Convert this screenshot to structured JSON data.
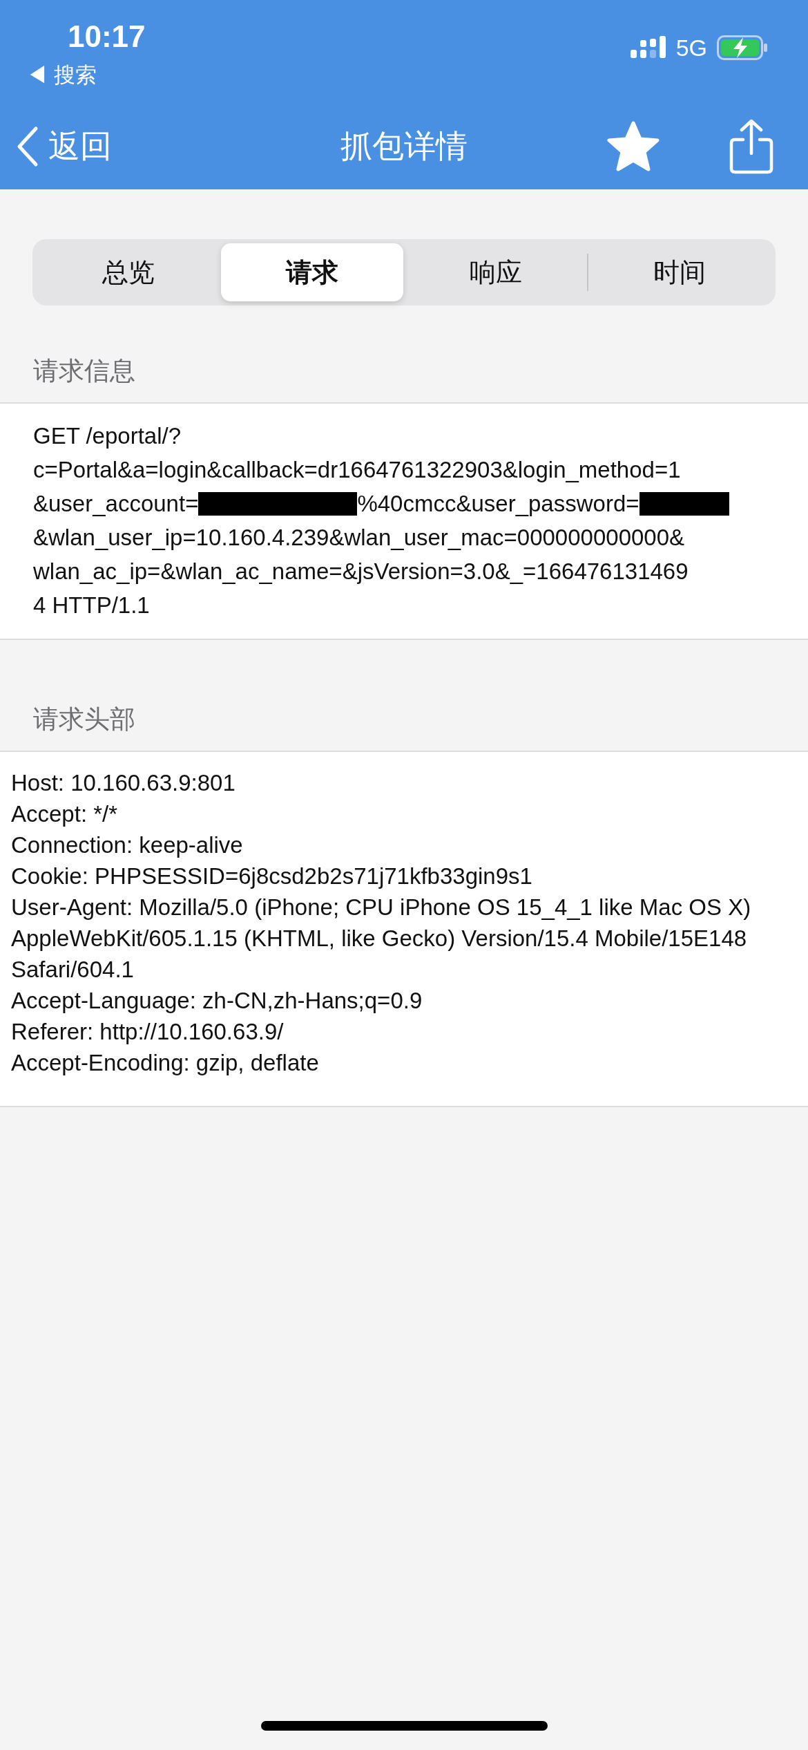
{
  "status_bar": {
    "time": "10:17",
    "back_app": "◀ 搜索",
    "network": "5G"
  },
  "nav_bar": {
    "back": "返回",
    "title": "抓包详情"
  },
  "tabs": [
    {
      "label": "总览",
      "selected": false
    },
    {
      "label": "请求",
      "selected": true
    },
    {
      "label": "响应",
      "selected": false
    },
    {
      "label": "时间",
      "selected": false
    }
  ],
  "request_info": {
    "heading": "请求信息",
    "lines": [
      [
        {
          "kind": "text",
          "text": "GET /eportal/?"
        }
      ],
      [
        {
          "kind": "text",
          "text": "c=Portal&a=login&callback=dr1664761322903&login_method=1"
        }
      ],
      [
        {
          "kind": "text",
          "text": "&user_account="
        },
        {
          "kind": "redacted"
        },
        {
          "kind": "text",
          "text": "%40cmcc&user_password="
        },
        {
          "kind": "redacted"
        }
      ],
      [
        {
          "kind": "text",
          "text": "&wlan_user_ip=10.160.4.239&wlan_user_mac=000000000000&"
        }
      ],
      [
        {
          "kind": "text",
          "text": "wlan_ac_ip=&wlan_ac_name=&jsVersion=3.0&_=166476131469"
        }
      ],
      [
        {
          "kind": "text",
          "text": "4 HTTP/1.1"
        }
      ]
    ]
  },
  "request_headers": {
    "heading": "请求头部",
    "lines": [
      "Host: 10.160.63.9:801",
      "Accept: */*",
      "Connection: keep-alive",
      "Cookie: PHPSESSID=6j8csd2b2s71j71kfb33gin9s1",
      "User-Agent: Mozilla/5.0 (iPhone; CPU iPhone OS 15_4_1 like Mac OS X) AppleWebKit/605.1.15 (KHTML, like Gecko) Version/15.4 Mobile/15E148 Safari/604.1",
      "Accept-Language: zh-CN,zh-Hans;q=0.9",
      "Referer: http://10.160.63.9/",
      "Accept-Encoding: gzip, deflate"
    ]
  }
}
